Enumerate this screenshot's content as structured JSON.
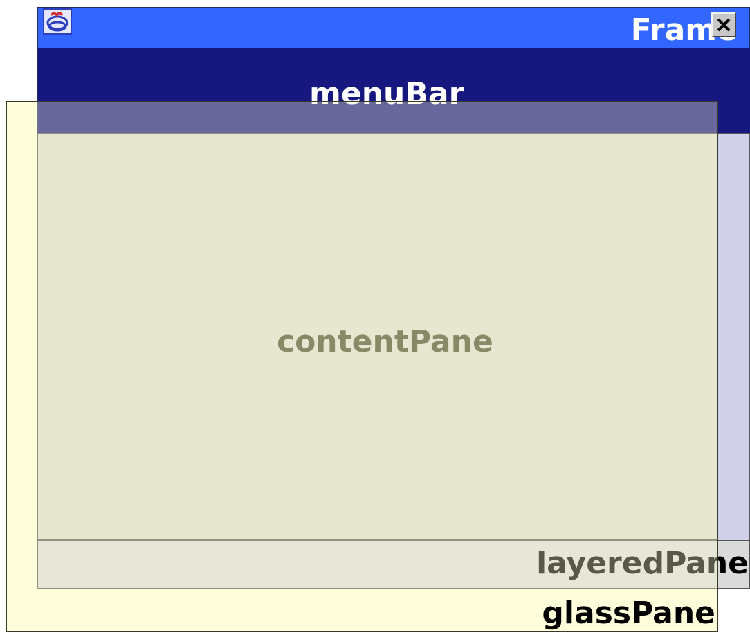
{
  "frame": {
    "title": "Frame",
    "icon": "java-duke-icon",
    "close_icon": "close-icon"
  },
  "menu_bar": {
    "label": "menuBar"
  },
  "content_pane": {
    "label": "contentPane"
  },
  "layered_pane": {
    "label": "layeredPane"
  },
  "glass_pane": {
    "label": "glassPane"
  },
  "colors": {
    "title_bar": "#3366ff",
    "menu_bar": "#171780",
    "layered_pane": "#d0d1e8",
    "content_pane": "#dbd9cf",
    "glass_pane": "#fdfde0"
  }
}
